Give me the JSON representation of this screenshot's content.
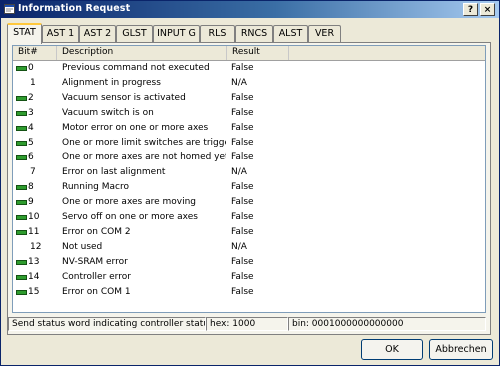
{
  "window": {
    "title": "Information Request",
    "help_label": "?",
    "close_label": "×"
  },
  "tabs": [
    "STAT",
    "AST 1",
    "AST 2",
    "GLST",
    "INPUT G",
    "RLS",
    "RNCS",
    "ALST",
    "VER"
  ],
  "active_tab": "STAT",
  "table": {
    "columns": [
      "Bit#",
      "Description",
      "Result"
    ],
    "rows": [
      {
        "bit": "0",
        "led": true,
        "description": "Previous command not executed",
        "result": "False"
      },
      {
        "bit": "1",
        "led": false,
        "description": "Alignment in progress",
        "result": "N/A"
      },
      {
        "bit": "2",
        "led": true,
        "description": "Vacuum sensor is activated",
        "result": "False"
      },
      {
        "bit": "3",
        "led": true,
        "description": "Vacuum switch is on",
        "result": "False"
      },
      {
        "bit": "4",
        "led": true,
        "description": "Motor error on one or more axes",
        "result": "False"
      },
      {
        "bit": "5",
        "led": true,
        "description": "One or more limit switches are trigge...",
        "result": "False"
      },
      {
        "bit": "6",
        "led": true,
        "description": "One or more axes are not homed yet",
        "result": "False"
      },
      {
        "bit": "7",
        "led": false,
        "description": "Error on last alignment",
        "result": "N/A"
      },
      {
        "bit": "8",
        "led": true,
        "description": "Running Macro",
        "result": "False"
      },
      {
        "bit": "9",
        "led": true,
        "description": "One or more axes are moving",
        "result": "False"
      },
      {
        "bit": "10",
        "led": true,
        "description": "Servo off on one or more axes",
        "result": "False"
      },
      {
        "bit": "11",
        "led": true,
        "description": "Error on COM 2",
        "result": "False"
      },
      {
        "bit": "12",
        "led": false,
        "description": "Not used",
        "result": "N/A"
      },
      {
        "bit": "13",
        "led": true,
        "description": "NV-SRAM error",
        "result": "False"
      },
      {
        "bit": "14",
        "led": true,
        "description": "Controller error",
        "result": "False"
      },
      {
        "bit": "15",
        "led": true,
        "description": "Error on COM 1",
        "result": "False"
      }
    ]
  },
  "status": {
    "message": "Send status word indicating controller status.",
    "hex": "hex: 1000",
    "bin": "bin: 0001000000000000"
  },
  "buttons": {
    "ok": "OK",
    "cancel": "Abbrechen"
  },
  "colors": {
    "led_green": "#2e9c2e",
    "title_start": "#0a246a",
    "title_end": "#a6caf0"
  }
}
